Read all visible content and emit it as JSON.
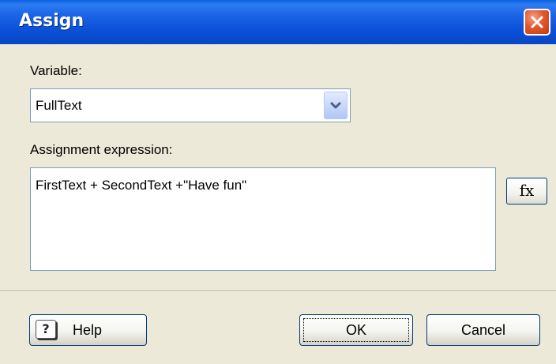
{
  "window": {
    "title": "Assign"
  },
  "variable": {
    "label": "Variable:",
    "value": "FullText"
  },
  "expression": {
    "label": "Assignment expression:",
    "value": "FirstText + SecondText +\"Have fun\"",
    "fx_label": "fx"
  },
  "buttons": {
    "help": "Help",
    "ok": "OK",
    "cancel": "Cancel"
  },
  "icons": {
    "close": "close-icon",
    "dropdown": "chevron-down-icon",
    "help": "help-icon",
    "function": "function-icon"
  },
  "colors": {
    "titlebar": "#0b4fd8",
    "close": "#e0592f",
    "background": "#ece9d8"
  }
}
